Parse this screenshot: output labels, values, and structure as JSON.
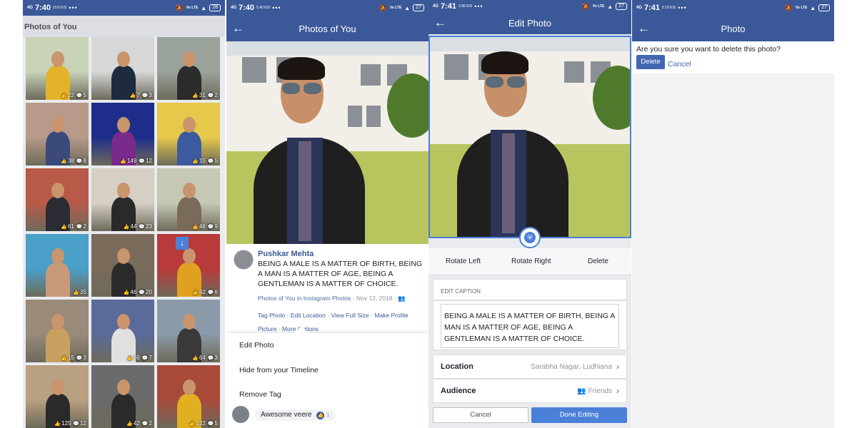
{
  "status_bars": [
    {
      "net": "4G",
      "time": "7:40",
      "speed": "10.0 K/S",
      "battery": "28"
    },
    {
      "net": "4G",
      "time": "7:40",
      "speed": "5.40 K/S",
      "battery": "27"
    },
    {
      "net": "4G",
      "time": "7:41",
      "speed": "2.86 K/S",
      "battery": "27"
    },
    {
      "net": "4G",
      "time": "7:41",
      "speed": "0.10 K/S",
      "battery": "27"
    }
  ],
  "screen1": {
    "header": "Photos of You",
    "tiles": [
      {
        "likes": "22",
        "comments": "5"
      },
      {
        "likes": "7",
        "comments": "3"
      },
      {
        "likes": "31",
        "comments": "2"
      },
      {
        "likes": "38",
        "comments": "8"
      },
      {
        "likes": "149",
        "comments": "12"
      },
      {
        "likes": "15",
        "comments": "5"
      },
      {
        "likes": "61",
        "comments": "2"
      },
      {
        "likes": "44",
        "comments": "23"
      },
      {
        "likes": "46",
        "comments": "9"
      },
      {
        "likes": "35",
        "comments": ""
      },
      {
        "likes": "46",
        "comments": "20"
      },
      {
        "likes": "42",
        "comments": "6"
      },
      {
        "likes": "15",
        "comments": "3"
      },
      {
        "likes": "69",
        "comments": "7"
      },
      {
        "likes": "64",
        "comments": "3"
      },
      {
        "likes": "125",
        "comments": "12"
      },
      {
        "likes": "42",
        "comments": "2"
      },
      {
        "likes": "122",
        "comments": "5"
      }
    ]
  },
  "screen2": {
    "title": "Photos of You",
    "author": "Pushkar Mehta",
    "caption": "BEING A MALE IS A MATTER OF BIRTH, BEING A MAN IS A MATTER OF AGE, BEING A GENTLEMAN IS A MATTER OF CHOICE.",
    "meta_album": "Photos of You in Instagram Photos",
    "meta_date": "· Nov 12, 2018 ·",
    "links": {
      "tag": "Tag Photo",
      "location": "Edit Location",
      "full": "View Full Size",
      "profile": "Make Profile Picture",
      "more": "More Options"
    },
    "menu": {
      "edit": "Edit Photo",
      "hide": "Hide from your Timeline",
      "remove": "Remove Tag"
    },
    "comment": {
      "text": "Awesome veere",
      "likes": "1"
    }
  },
  "screen3": {
    "title": "Edit Photo",
    "toolbar": {
      "rotate_left": "Rotate Left",
      "rotate_right": "Rotate Right",
      "delete": "Delete"
    },
    "caption_label": "EDIT CAPTION",
    "caption": "BEING A MALE IS A MATTER OF BIRTH, BEING A MAN IS A MATTER OF AGE, BEING A GENTLEMAN IS A MATTER OF CHOICE.",
    "location_label": "Location",
    "location_value": "Sarabha Nagar, Ludhiana",
    "audience_label": "Audience",
    "audience_value": "Friends",
    "cancel": "Cancel",
    "done": "Done Editing"
  },
  "screen4": {
    "title": "Photo",
    "question": "Are you sure you want to delete this photo?",
    "delete": "Delete",
    "cancel": "Cancel"
  },
  "colors": {
    "brand": "#3b5998",
    "accent": "#4a80d8"
  }
}
